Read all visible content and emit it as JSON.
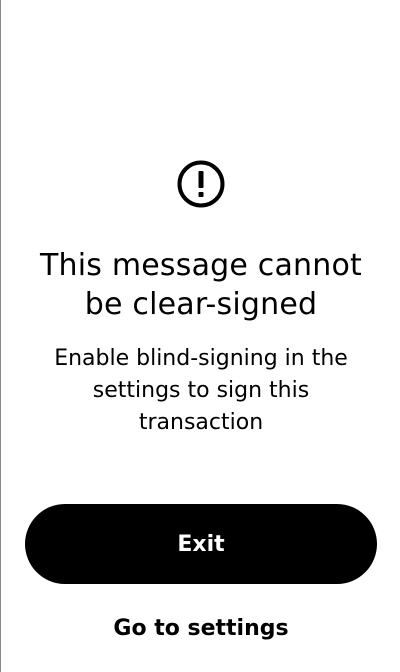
{
  "screen": {
    "icon": "exclamation-circle-icon",
    "title_line1": "This message cannot",
    "title_line2": "be clear-signed",
    "description_line1": "Enable blind-signing in the",
    "description_line2": "settings to sign this",
    "description_line3": "transaction"
  },
  "actions": {
    "exit_label": "Exit",
    "settings_label": "Go to settings"
  },
  "colors": {
    "background": "#ffffff",
    "foreground": "#000000",
    "button_text": "#ffffff"
  }
}
